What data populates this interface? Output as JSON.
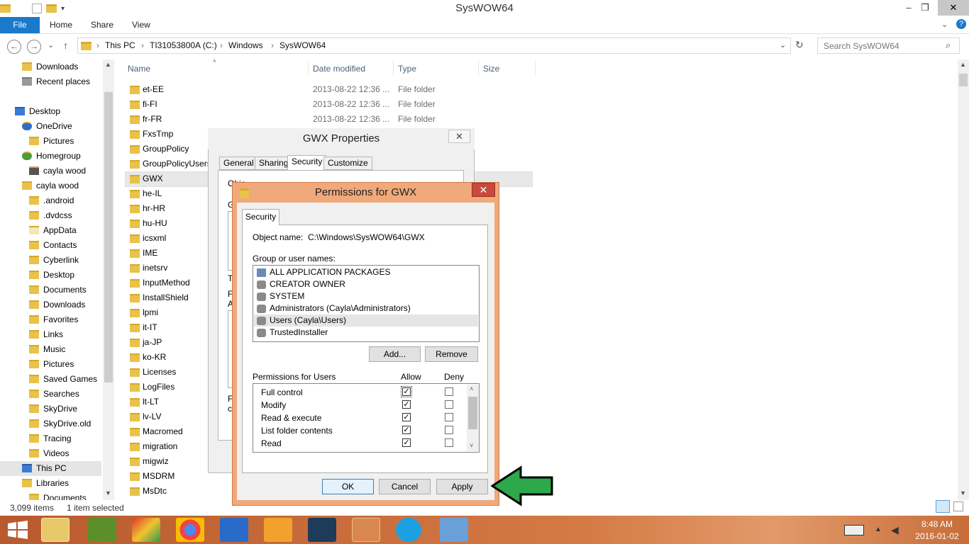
{
  "window": {
    "title": "SysWOW64",
    "minimize": "–",
    "maximize": "❐",
    "close": "✕"
  },
  "ribbon": {
    "file": "File",
    "home": "Home",
    "share": "Share",
    "view": "View",
    "help": "?"
  },
  "nav": {
    "back": "←",
    "forward": "→",
    "recent": "⌄",
    "up": "↑",
    "refresh": "↻"
  },
  "address": {
    "crumbs": [
      "This PC",
      "TI31053800A (C:)",
      "Windows",
      "SysWOW64"
    ]
  },
  "search": {
    "placeholder": "Search SysWOW64"
  },
  "navpane": {
    "items": [
      "Downloads",
      "Recent places",
      "Desktop",
      "OneDrive",
      "Pictures",
      "Homegroup",
      "cayla wood",
      "cayla wood",
      ".android",
      ".dvdcss",
      "AppData",
      "Contacts",
      "Cyberlink",
      "Desktop",
      "Documents",
      "Downloads",
      "Favorites",
      "Links",
      "Music",
      "Pictures",
      "Saved Games",
      "Searches",
      "SkyDrive",
      "SkyDrive.old",
      "Tracing",
      "Videos",
      "This PC",
      "Libraries",
      "Documents"
    ]
  },
  "columns": {
    "name": "Name",
    "date": "Date modified",
    "type": "Type",
    "size": "Size"
  },
  "files": [
    {
      "name": "et-EE",
      "date": "2013-08-22 12:36 ...",
      "type": "File folder"
    },
    {
      "name": "fi-FI",
      "date": "2013-08-22 12:36 ...",
      "type": "File folder"
    },
    {
      "name": "fr-FR",
      "date": "2013-08-22 12:36 ...",
      "type": "File folder"
    },
    {
      "name": "FxsTmp",
      "date": "",
      "type": ""
    },
    {
      "name": "GroupPolicy",
      "date": "",
      "type": ""
    },
    {
      "name": "GroupPolicyUsers",
      "date": "",
      "type": ""
    },
    {
      "name": "GWX",
      "date": "",
      "type": ""
    },
    {
      "name": "he-IL",
      "date": "",
      "type": ""
    },
    {
      "name": "hr-HR",
      "date": "",
      "type": ""
    },
    {
      "name": "hu-HU",
      "date": "",
      "type": ""
    },
    {
      "name": "icsxml",
      "date": "",
      "type": ""
    },
    {
      "name": "IME",
      "date": "",
      "type": ""
    },
    {
      "name": "inetsrv",
      "date": "",
      "type": ""
    },
    {
      "name": "InputMethod",
      "date": "",
      "type": ""
    },
    {
      "name": "InstallShield",
      "date": "",
      "type": ""
    },
    {
      "name": "lpmi",
      "date": "",
      "type": ""
    },
    {
      "name": "it-IT",
      "date": "",
      "type": ""
    },
    {
      "name": "ja-JP",
      "date": "",
      "type": ""
    },
    {
      "name": "ko-KR",
      "date": "",
      "type": ""
    },
    {
      "name": "Licenses",
      "date": "",
      "type": ""
    },
    {
      "name": "LogFiles",
      "date": "",
      "type": ""
    },
    {
      "name": "lt-LT",
      "date": "",
      "type": ""
    },
    {
      "name": "lv-LV",
      "date": "",
      "type": ""
    },
    {
      "name": "Macromed",
      "date": "",
      "type": ""
    },
    {
      "name": "migration",
      "date": "",
      "type": ""
    },
    {
      "name": "migwiz",
      "date": "",
      "type": ""
    },
    {
      "name": "MSDRM",
      "date": "",
      "type": ""
    },
    {
      "name": "MsDtc",
      "date": "",
      "type": ""
    }
  ],
  "status": {
    "count": "3,099 items",
    "selected": "1 item selected"
  },
  "props": {
    "title": "GWX Properties",
    "close": "✕",
    "tabs": [
      "General",
      "Sharing",
      "Security",
      "Customize"
    ],
    "hidden_labels": [
      "Obje",
      "G",
      "T",
      "F",
      "A",
      "F",
      "c"
    ]
  },
  "perm": {
    "title": "Permissions for GWX",
    "close": "✕",
    "tab": "Security",
    "object_label": "Object name:",
    "object_value": "C:\\Windows\\SysWOW64\\GWX",
    "group_label": "Group or user names:",
    "groups": [
      "ALL APPLICATION PACKAGES",
      "CREATOR OWNER",
      "SYSTEM",
      "Administrators (Cayla\\Administrators)",
      "Users (Cayla\\Users)",
      "TrustedInstaller"
    ],
    "add": "Add...",
    "remove": "Remove",
    "perm_label": "Permissions for Users",
    "allow": "Allow",
    "deny": "Deny",
    "permissions": [
      {
        "name": "Full control",
        "allow": true,
        "deny": false
      },
      {
        "name": "Modify",
        "allow": true,
        "deny": false
      },
      {
        "name": "Read & execute",
        "allow": true,
        "deny": false
      },
      {
        "name": "List folder contents",
        "allow": true,
        "deny": false
      },
      {
        "name": "Read",
        "allow": true,
        "deny": false
      }
    ],
    "ok": "OK",
    "cancel": "Cancel",
    "apply": "Apply"
  },
  "taskbar": {
    "time": "8:48 AM",
    "date": "2016-01-02"
  },
  "colors": {
    "accent": "#1979ca",
    "arrow": "#2da84a",
    "dialog_frame": "#f0a97a",
    "close_red": "#c74a3c"
  }
}
